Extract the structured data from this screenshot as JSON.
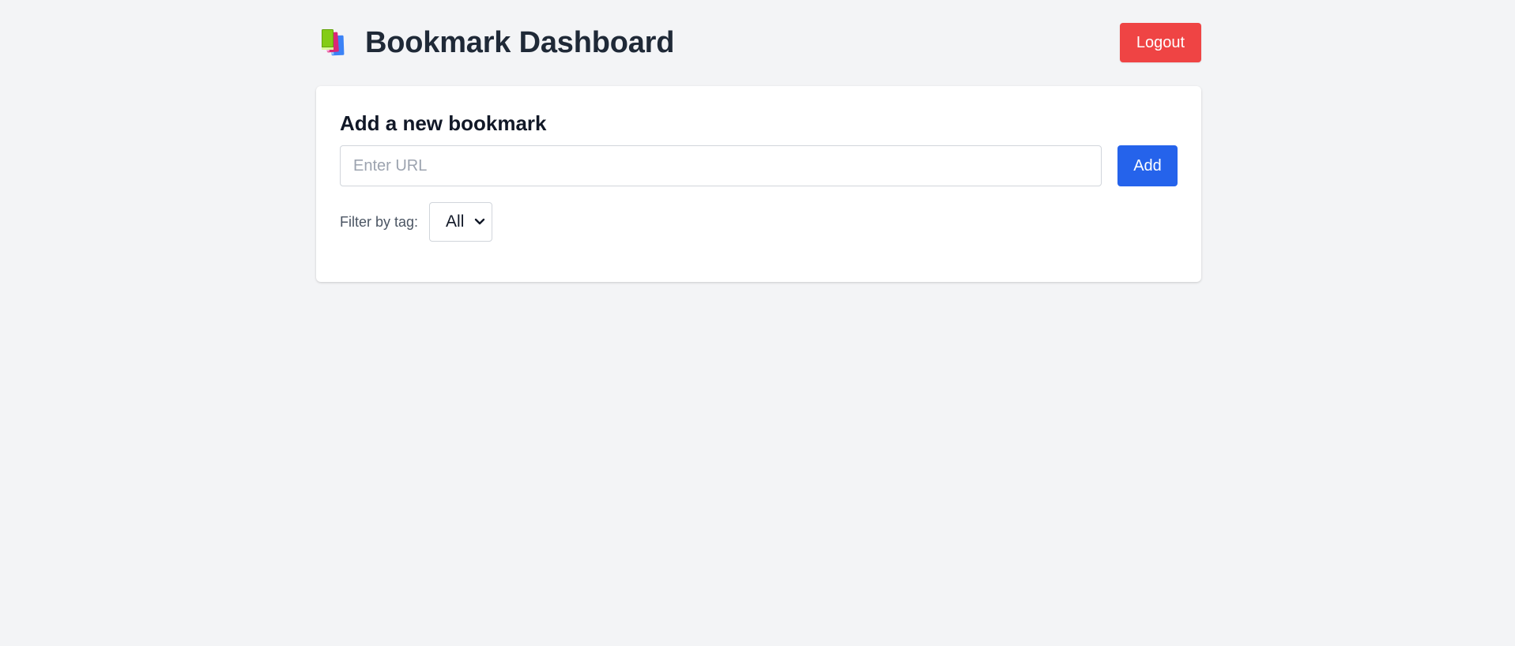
{
  "header": {
    "title": "Bookmark Dashboard",
    "icon": "books-icon",
    "logout_label": "Logout"
  },
  "add_card": {
    "heading": "Add a new bookmark",
    "url_input": {
      "value": "",
      "placeholder": "Enter URL"
    },
    "add_label": "Add",
    "filter": {
      "label": "Filter by tag:",
      "selected": "All"
    }
  },
  "colors": {
    "background": "#f3f4f6",
    "logout": "#ef4444",
    "add": "#2563eb",
    "card": "#ffffff",
    "title_text": "#1f2937"
  }
}
